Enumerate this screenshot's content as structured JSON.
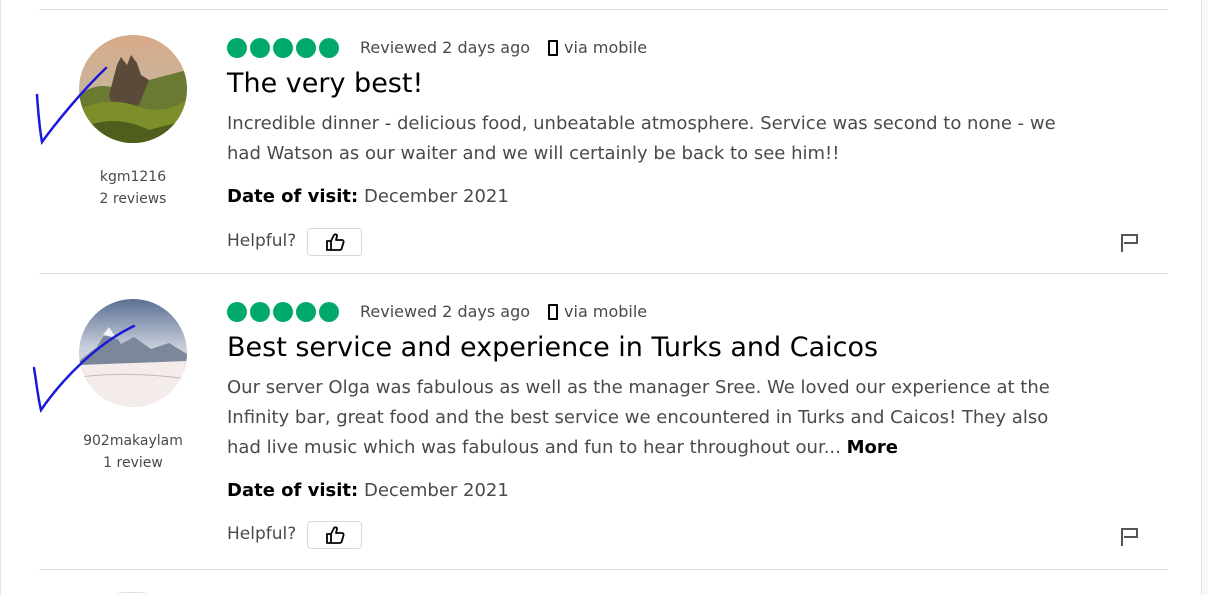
{
  "reviews": [
    {
      "username": "kgm1216",
      "review_count": "2 reviews",
      "rating": 5,
      "reviewed": "Reviewed 2 days ago",
      "via": "via mobile",
      "title": "The very best!",
      "body": "Incredible dinner - delicious food, unbeatable atmosphere. Service was second to none - we had Watson as our waiter and we will certainly be back to see him!!",
      "more": "",
      "date_label": "Date of visit:",
      "date_value": "December 2021",
      "helpful_label": "Helpful?"
    },
    {
      "username": "902makaylam",
      "review_count": "1 review",
      "rating": 5,
      "reviewed": "Reviewed 2 days ago",
      "via": "via mobile",
      "title": "Best service and experience in Turks and Caicos",
      "body": "Our server Olga was fabulous as well as the manager Sree. We loved our experience at the Infinity bar, great food and the best service we encountered in Turks and Caicos! They also had live music which was fabulous and fun to hear throughout our...",
      "more": "More",
      "date_label": "Date of visit:",
      "date_value": "December 2021",
      "helpful_label": "Helpful?"
    }
  ],
  "colors": {
    "bubble": "#00aa6c",
    "check_mark": "#1a1adb"
  },
  "icons": [
    "mobile-phone-icon",
    "thumbs-up-icon",
    "report-flag-icon"
  ]
}
